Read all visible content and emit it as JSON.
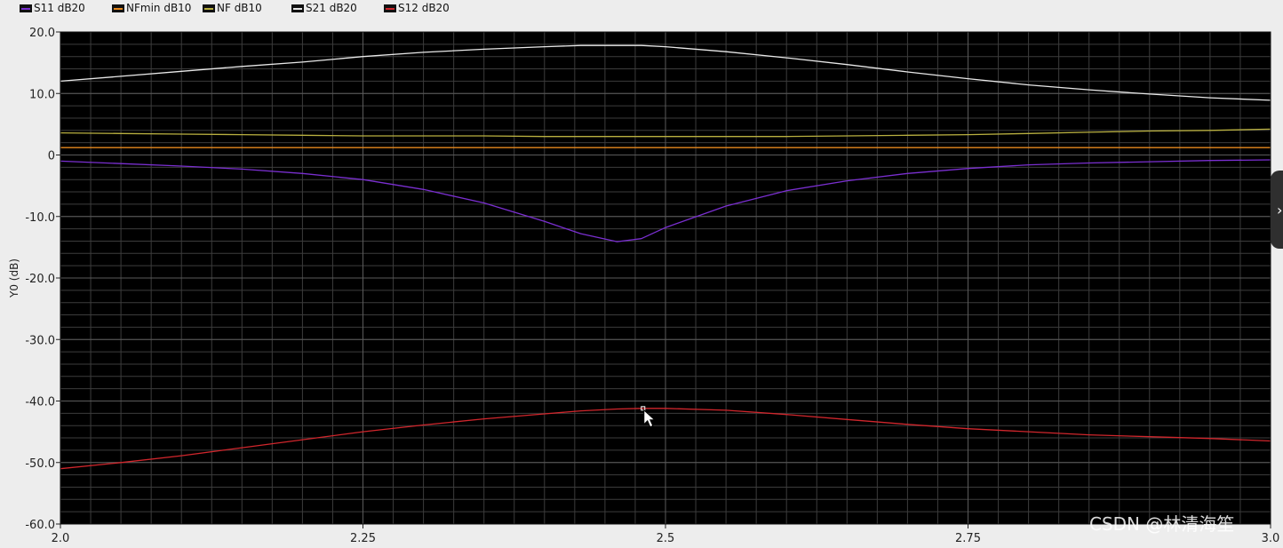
{
  "legend": [
    {
      "label": "S11 dB20",
      "color": "#7a2fd0"
    },
    {
      "label": "NFmin dB10",
      "color": "#e88a1e"
    },
    {
      "label": "NF dB10",
      "color": "#b9b040"
    },
    {
      "label": "S21 dB20",
      "color": "#e8e8e8"
    },
    {
      "label": "S12 dB20",
      "color": "#d0262c"
    }
  ],
  "watermark": "CSDN @林清海笙",
  "side_handle_glyph": "›",
  "chart_data": {
    "type": "line",
    "title": "",
    "xlabel": "",
    "ylabel": "Y0 (dB)",
    "xlim": [
      2.0,
      3.0
    ],
    "ylim": [
      -60,
      20
    ],
    "x_ticks": [
      2.0,
      2.25,
      2.5,
      2.75,
      3.0
    ],
    "x_tick_labels": [
      "2.0",
      "2.25",
      "2.5",
      "2.75",
      "3.0"
    ],
    "y_ticks": [
      20,
      10,
      0,
      -10,
      -20,
      -30,
      -40,
      -50,
      -60
    ],
    "y_tick_labels": [
      "20.0",
      "10.0",
      "0",
      "-10.0",
      "-20.0",
      "-30.0",
      "-40.0",
      "-50.0",
      "-60.0"
    ],
    "grid": true,
    "background": "#000000",
    "grid_color": "#3c3c3c",
    "legend_position": "top-left",
    "x": [
      2.0,
      2.05,
      2.1,
      2.15,
      2.2,
      2.25,
      2.3,
      2.35,
      2.4,
      2.43,
      2.46,
      2.48,
      2.5,
      2.55,
      2.6,
      2.65,
      2.7,
      2.75,
      2.8,
      2.85,
      2.9,
      2.95,
      3.0
    ],
    "series": [
      {
        "name": "S11 dB20",
        "color": "#7a2fd0",
        "values": [
          -1.0,
          -1.4,
          -1.8,
          -2.3,
          -3.0,
          -4.0,
          -5.6,
          -7.8,
          -10.8,
          -12.8,
          -14.1,
          -13.6,
          -11.8,
          -8.3,
          -5.8,
          -4.2,
          -3.0,
          -2.2,
          -1.6,
          -1.3,
          -1.1,
          -0.9,
          -0.8
        ]
      },
      {
        "name": "NFmin dB10",
        "color": "#e88a1e",
        "values": [
          1.2,
          1.2,
          1.2,
          1.2,
          1.2,
          1.2,
          1.2,
          1.2,
          1.2,
          1.2,
          1.2,
          1.2,
          1.2,
          1.2,
          1.2,
          1.2,
          1.2,
          1.2,
          1.2,
          1.2,
          1.2,
          1.2,
          1.2
        ]
      },
      {
        "name": "NF dB10",
        "color": "#b9b040",
        "values": [
          3.6,
          3.5,
          3.4,
          3.3,
          3.2,
          3.1,
          3.1,
          3.1,
          3.0,
          3.0,
          3.0,
          3.0,
          3.0,
          3.0,
          3.0,
          3.1,
          3.2,
          3.3,
          3.5,
          3.7,
          3.9,
          4.0,
          4.2
        ]
      },
      {
        "name": "S21 dB20",
        "color": "#e8e8e8",
        "values": [
          12.0,
          12.8,
          13.6,
          14.4,
          15.1,
          16.0,
          16.7,
          17.2,
          17.6,
          17.8,
          17.8,
          17.8,
          17.6,
          16.8,
          15.8,
          14.7,
          13.5,
          12.4,
          11.4,
          10.6,
          9.9,
          9.3,
          8.9
        ]
      },
      {
        "name": "S12 dB20",
        "color": "#d0262c",
        "values": [
          -51.0,
          -50.0,
          -48.9,
          -47.6,
          -46.3,
          -45.0,
          -43.9,
          -42.9,
          -42.1,
          -41.6,
          -41.3,
          -41.2,
          -41.2,
          -41.5,
          -42.2,
          -43.0,
          -43.8,
          -44.5,
          -45.0,
          -45.5,
          -45.8,
          -46.1,
          -46.5
        ]
      }
    ]
  }
}
